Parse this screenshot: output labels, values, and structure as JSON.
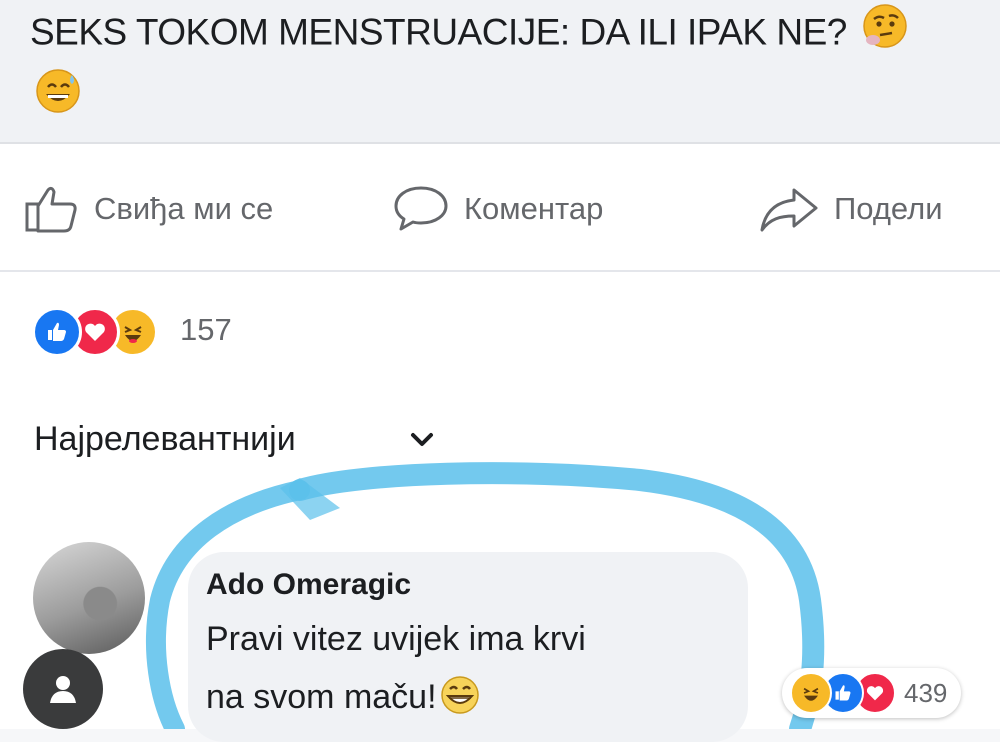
{
  "post": {
    "title": "SEKS TOKOM MENSTRUACIJE: DA ILI IPAK NE?",
    "title_emojis": [
      "thinking-face-icon",
      "grinning-sweat-icon"
    ]
  },
  "actions": {
    "like_label": "Свиђа ми се",
    "comment_label": "Коментар",
    "share_label": "Подели"
  },
  "reactions": {
    "icons": [
      "like",
      "love",
      "haha"
    ],
    "count": "157"
  },
  "sort": {
    "label": "Најрелевантнији"
  },
  "comment": {
    "author": "Ado Omeragic",
    "line1": "Pravi vitez uvijek ima krvi",
    "line2": "na svom maču!",
    "emoji": "grin-icon",
    "reaction_icons": [
      "haha",
      "like",
      "love"
    ],
    "reaction_count": "439"
  },
  "colors": {
    "like_blue": "#1877f2",
    "love_red": "#f0284a",
    "haha_yellow": "#f7b928",
    "highlight_ring": "#5bc0eb"
  }
}
